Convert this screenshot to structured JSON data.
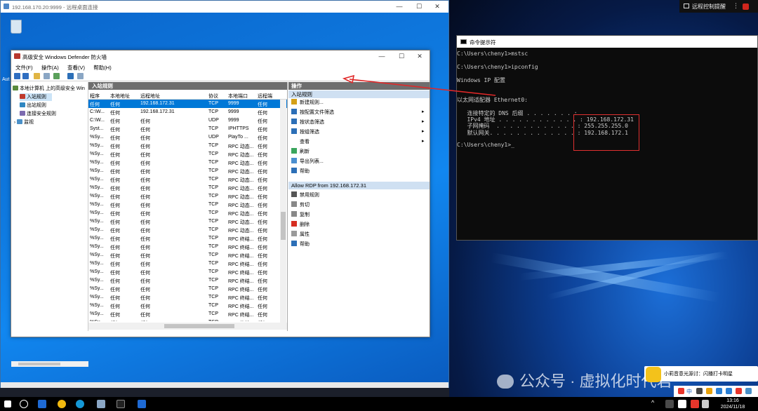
{
  "rdp": {
    "title": "192.168.170.20:9999 - 远程桌面连接",
    "min": "—",
    "max": "☐",
    "close": "✕"
  },
  "host": {
    "remote_control_label": "远程控制提醒",
    "watermark": "公众号 · 虚拟化时代君",
    "toast_text": "小莉音意光源讨：闪播打卡明星",
    "clock_time": "13:16",
    "clock_date": "2024/11/18",
    "tray_ime": "中"
  },
  "desktop": {
    "recycle_label": "回收站",
    "side_label": "Aut"
  },
  "mmc": {
    "title": "高级安全 Windows Defender 防火墙",
    "min": "—",
    "max": "☐",
    "close": "✕",
    "menu": [
      "文件(F)",
      "操作(A)",
      "查看(V)",
      "帮助(H)"
    ],
    "tree": [
      {
        "label": "本地计算机 上的高级安全 Win",
        "color": "#5a8a3c"
      },
      {
        "label": "入站规则",
        "color": "#c0392b"
      },
      {
        "label": "出站规则",
        "color": "#2e86c1"
      },
      {
        "label": "连接安全规则",
        "color": "#7d6bb0"
      },
      {
        "label": "监视",
        "color": "#4a90c8"
      }
    ],
    "center_title": "入站规则",
    "columns": [
      "程序",
      "本地地址",
      "远程地址",
      "协议",
      "本地端口",
      "远程端"
    ],
    "rows": [
      [
        "任何",
        "任何",
        "192.168.172.31",
        "TCP",
        "9999",
        "任何"
      ],
      [
        "C:\\W...",
        "任何",
        "192.168.172.31",
        "TCP",
        "9999",
        "任何"
      ],
      [
        "C:\\W...",
        "任何",
        "任何",
        "UDP",
        "9999",
        "任何"
      ],
      [
        "Syst...",
        "任何",
        "任何",
        "TCP",
        "IPHTTPS",
        "任何"
      ],
      [
        "%Sy...",
        "任何",
        "任何",
        "UDP",
        "PlayTo ...",
        "任何"
      ],
      [
        "%Sy...",
        "任何",
        "任何",
        "TCP",
        "RPC 动态...",
        "任何"
      ],
      [
        "%Sy...",
        "任何",
        "任何",
        "TCP",
        "RPC 动态...",
        "任何"
      ],
      [
        "%Sy...",
        "任何",
        "任何",
        "TCP",
        "RPC 动态...",
        "任何"
      ],
      [
        "%Sy...",
        "任何",
        "任何",
        "TCP",
        "RPC 动态...",
        "任何"
      ],
      [
        "%Sy...",
        "任何",
        "任何",
        "TCP",
        "RPC 动态...",
        "任何"
      ],
      [
        "%Sy...",
        "任何",
        "任何",
        "TCP",
        "RPC 动态...",
        "任何"
      ],
      [
        "%Sy...",
        "任何",
        "任何",
        "TCP",
        "RPC 动态...",
        "任何"
      ],
      [
        "%Sy...",
        "任何",
        "任何",
        "TCP",
        "RPC 动态...",
        "任何"
      ],
      [
        "%Sy...",
        "任何",
        "任何",
        "TCP",
        "RPC 动态...",
        "任何"
      ],
      [
        "%Sy...",
        "任何",
        "任何",
        "TCP",
        "RPC 动态...",
        "任何"
      ],
      [
        "%Sy...",
        "任何",
        "任何",
        "TCP",
        "RPC 动态...",
        "任何"
      ],
      [
        "%Sy...",
        "任何",
        "任何",
        "TCP",
        "RPC 终结...",
        "任何"
      ],
      [
        "%Sy...",
        "任何",
        "任何",
        "TCP",
        "RPC 终结...",
        "任何"
      ],
      [
        "%Sy...",
        "任何",
        "任何",
        "TCP",
        "RPC 终结...",
        "任何"
      ],
      [
        "%Sy...",
        "任何",
        "任何",
        "TCP",
        "RPC 终结...",
        "任何"
      ],
      [
        "%Sy...",
        "任何",
        "任何",
        "TCP",
        "RPC 终结...",
        "任何"
      ],
      [
        "%Sy...",
        "任何",
        "任何",
        "TCP",
        "RPC 终结...",
        "任何"
      ],
      [
        "%Sy...",
        "任何",
        "任何",
        "TCP",
        "RPC 终结...",
        "任何"
      ],
      [
        "%Sy...",
        "任何",
        "任何",
        "TCP",
        "RPC 终结...",
        "任何"
      ],
      [
        "%Sy...",
        "任何",
        "任何",
        "TCP",
        "RPC 终结...",
        "任何"
      ],
      [
        "%Sy...",
        "任何",
        "任何",
        "TCP",
        "RPC 终结...",
        "任何"
      ],
      [
        "%Sy...",
        "任何",
        "任何",
        "TCP",
        "RPC 终结...",
        "任何"
      ]
    ],
    "actions_title": "操作",
    "actions_section1": "入站规则",
    "actions1": [
      {
        "label": "新建规则...",
        "icon": "#d4a017",
        "arrow": ""
      },
      {
        "label": "按配置文件筛选",
        "icon": "#2c6fb7",
        "arrow": "▸"
      },
      {
        "label": "按状态筛选",
        "icon": "#2c6fb7",
        "arrow": "▸"
      },
      {
        "label": "按组筛选",
        "icon": "#2c6fb7",
        "arrow": "▸"
      },
      {
        "label": "查看",
        "icon": "",
        "arrow": "▸"
      },
      {
        "label": "刷新",
        "icon": "#3aa55d",
        "arrow": ""
      },
      {
        "label": "导出列表...",
        "icon": "#4a8fd0",
        "arrow": ""
      },
      {
        "label": "帮助",
        "icon": "#2c6fb7",
        "arrow": ""
      }
    ],
    "actions_section2": "Allow RDP from 192.168.172.31",
    "actions2": [
      {
        "label": "禁用规则",
        "icon": "#555555"
      },
      {
        "label": "剪切",
        "icon": "#888888"
      },
      {
        "label": "复制",
        "icon": "#888888"
      },
      {
        "label": "删除",
        "icon": "#d62d20"
      },
      {
        "label": "属性",
        "icon": "#9a9a9a"
      },
      {
        "label": "帮助",
        "icon": "#2c6fb7"
      }
    ]
  },
  "cmd": {
    "title": "命令提示符",
    "lines": [
      "C:\\Users\\cheny1>mstsc",
      "",
      "C:\\Users\\cheny1>ipconfig",
      "",
      "Windows IP 配置",
      "",
      "",
      "以太网适配器 Ethernet0:",
      "",
      "   连接特定的 DNS 后缀 . . . . . . . :",
      "   IPv4 地址 . . . . . . . . . . . . : 192.168.172.31",
      "   子网掩码  . . . . . . . . . . . . : 255.255.255.0",
      "   默认网关. . . . . . . . . . . . . : 192.168.172.1",
      "",
      "C:\\Users\\cheny1>_"
    ]
  }
}
